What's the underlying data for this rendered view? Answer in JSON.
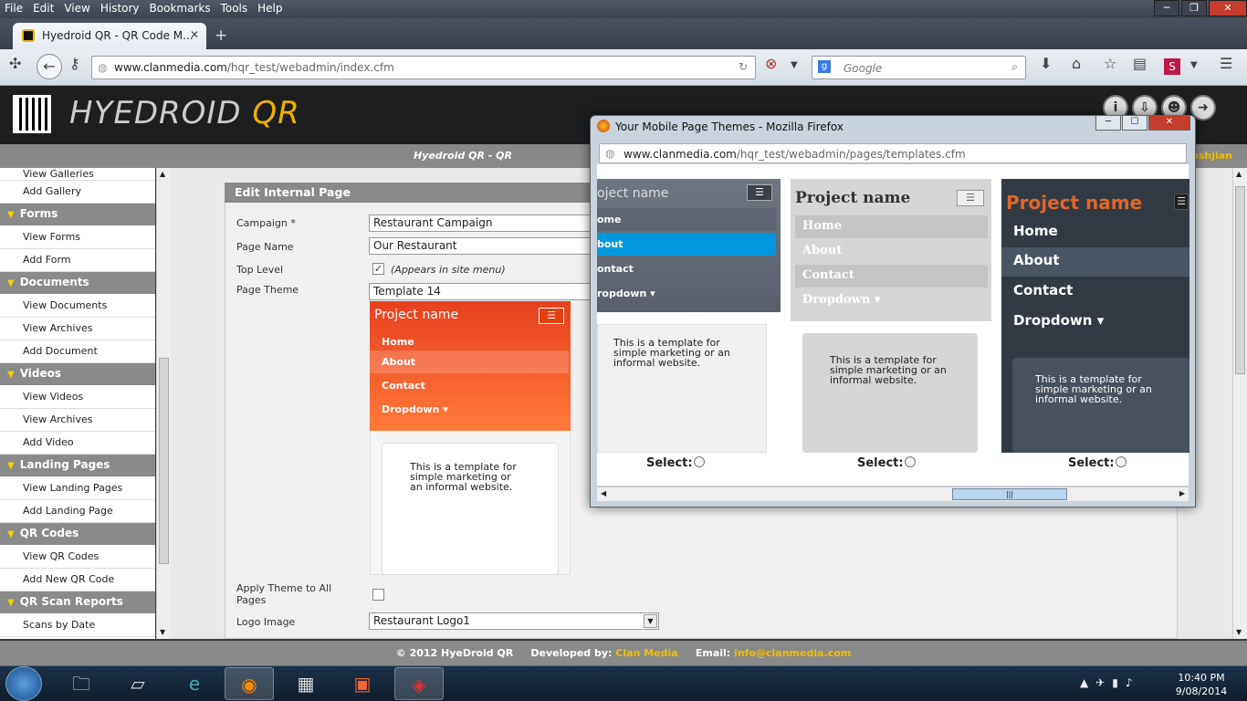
{
  "browser": {
    "menu": [
      "File",
      "Edit",
      "View",
      "History",
      "Bookmarks",
      "Tools",
      "Help"
    ],
    "tab_title": "Hyedroid QR - QR Code M...",
    "url_host": "www.clanmedia.com",
    "url_path": "/hqr_test/webadmin/index.cfm",
    "search_placeholder": "Google"
  },
  "site": {
    "brand_a": "HYEDROID",
    "brand_b": "QR",
    "topbar_title": "Hyedroid QR - QR",
    "topbar_user": "ashjian"
  },
  "sidebar": {
    "items": [
      {
        "type": "item",
        "label": "View Galleries"
      },
      {
        "type": "item",
        "label": "Add Gallery"
      },
      {
        "type": "head",
        "label": "Forms"
      },
      {
        "type": "item",
        "label": "View Forms"
      },
      {
        "type": "item",
        "label": "Add Form"
      },
      {
        "type": "head",
        "label": "Documents"
      },
      {
        "type": "item",
        "label": "View Documents"
      },
      {
        "type": "item",
        "label": "View Archives"
      },
      {
        "type": "item",
        "label": "Add Document"
      },
      {
        "type": "head",
        "label": "Videos"
      },
      {
        "type": "item",
        "label": "View Videos"
      },
      {
        "type": "item",
        "label": "View Archives"
      },
      {
        "type": "item",
        "label": "Add Video"
      },
      {
        "type": "head",
        "label": "Landing Pages"
      },
      {
        "type": "item",
        "label": "View Landing Pages"
      },
      {
        "type": "item",
        "label": "Add Landing Page"
      },
      {
        "type": "head",
        "label": "QR Codes"
      },
      {
        "type": "item",
        "label": "View QR Codes"
      },
      {
        "type": "item",
        "label": "Add New QR Code"
      },
      {
        "type": "head",
        "label": "QR Scan Reports"
      },
      {
        "type": "item",
        "label": "Scans by Date"
      }
    ]
  },
  "form": {
    "heading": "Edit Internal Page",
    "campaign_label": "Campaign *",
    "campaign_value": "Restaurant Campaign",
    "page_name_label": "Page Name",
    "page_name_value": "Our Restaurant",
    "top_level_label": "Top Level",
    "top_level_hint": "(Appears in site menu)",
    "theme_label": "Page Theme",
    "theme_value": "Template 14",
    "apply_theme_label_1": "Apply Theme to All",
    "apply_theme_label_2": "Pages",
    "logo_label": "Logo Image",
    "logo_value": "Restaurant Logo1"
  },
  "preview": {
    "project_name": "Project name",
    "nav": [
      "Home",
      "About",
      "Contact",
      "Dropdown ▾"
    ],
    "body_1": "This is a template for",
    "body_2": "simple marketing or",
    "body_3": "an informal website."
  },
  "footer": {
    "copyright": "© 2012 HyeDroid QR",
    "developed_label": "Developed by:",
    "developer": "Clan Media",
    "email_label": "Email:",
    "email": "info@clanmedia.com"
  },
  "popup": {
    "title": "Your Mobile Page Themes - Mozilla Firefox",
    "url_host": "www.clanmedia.com",
    "url_path": "/hqr_test/webadmin/pages/templates.cfm",
    "themeA": {
      "title": "oject name",
      "nav": [
        "ome",
        "bout",
        "ontact",
        "ropdown ▾"
      ],
      "body_1": "This is a template for",
      "body_2": "simple marketing or an",
      "body_3": "informal website."
    },
    "themeB": {
      "title": "Project name",
      "nav": [
        "Home",
        "About",
        "Contact",
        "Dropdown ▾"
      ],
      "body_1": "This is a template for",
      "body_2": "simple marketing or an",
      "body_3": "informal website."
    },
    "themeC": {
      "title": "Project name",
      "nav": [
        "Home",
        "About",
        "Contact",
        "Dropdown ▾"
      ],
      "body_1": "This is a template for",
      "body_2": "simple marketing or an",
      "body_3": "informal website."
    },
    "select_label": "Select:"
  },
  "taskbar": {
    "time": "10:40 PM",
    "date": "9/08/2014"
  },
  "colors": {
    "accent_orange": "#ff6a2a",
    "highlight_yellow": "#f0c000",
    "about_blue": "#0099dd"
  }
}
